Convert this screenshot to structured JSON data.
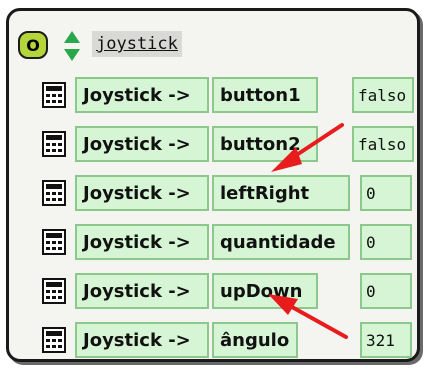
{
  "header": {
    "badge": "O",
    "title": "joystick"
  },
  "rows": [
    {
      "object": "Joystick ->",
      "property": "button1",
      "value": "falso"
    },
    {
      "object": "Joystick ->",
      "property": "button2",
      "value": "falso"
    },
    {
      "object": "Joystick ->",
      "property": "leftRight",
      "value": "0"
    },
    {
      "object": "Joystick ->",
      "property": "quantidade",
      "value": "0"
    },
    {
      "object": "Joystick ->",
      "property": "upDown",
      "value": "0"
    },
    {
      "object": "Joystick ->",
      "property": "ângulo",
      "value": "321"
    }
  ],
  "colors": {
    "cell_fill": "#d6f5d4",
    "cell_border": "#8cc88c",
    "badge": "#b4d63a",
    "annotation_arrow": "#e81c1c"
  },
  "icons": {
    "row": "calculator-icon",
    "header_arrows": "up-down-arrows-icon"
  }
}
